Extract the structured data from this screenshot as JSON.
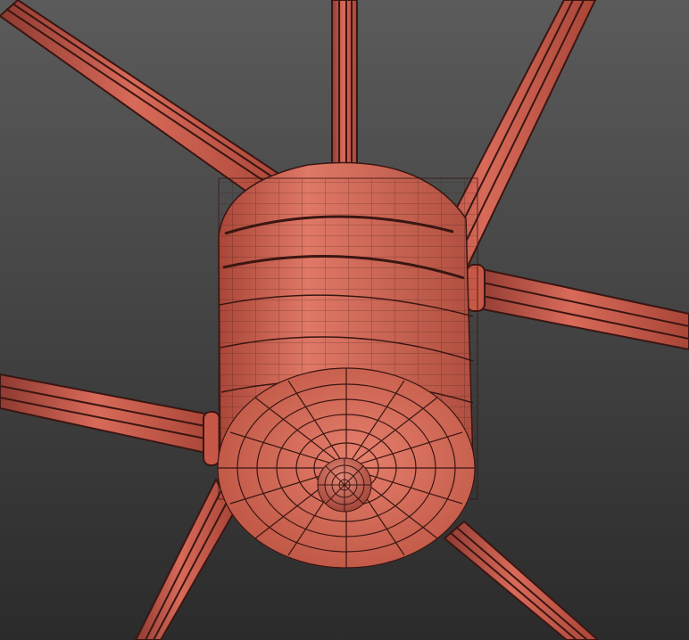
{
  "scene": {
    "background_top": "#5b5b5b",
    "background_bottom": "#2b2b2b",
    "material_light": "#e07a68",
    "material_mid": "#c9594a",
    "material_dark": "#8f3a31",
    "wire_color": "#3a1612",
    "objects": [
      "rod-top",
      "rod-upper-left",
      "rod-upper-right",
      "rod-right",
      "rod-left",
      "rod-lower-left",
      "rod-lower-right",
      "hub-cylinder",
      "hub-end-cap",
      "center-knob"
    ]
  }
}
